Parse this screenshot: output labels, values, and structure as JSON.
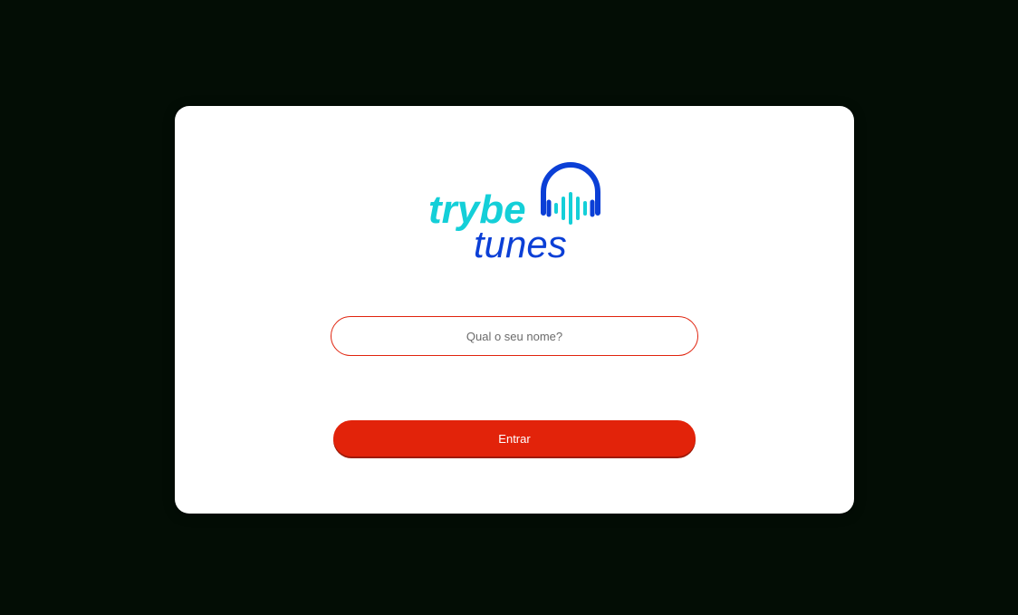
{
  "logo": {
    "word1": "trybe",
    "word2": "tunes",
    "icon": "headphones-soundwave-icon",
    "colors": {
      "trybe": "#14cfd8",
      "tunes": "#0b3fd6",
      "headphones": "#0b3fd6",
      "wave": "#14cfd8"
    }
  },
  "login": {
    "name_placeholder": "Qual o seu nome?",
    "name_value": "",
    "submit_label": "Entrar"
  },
  "colors": {
    "background": "#030d05",
    "card": "#ffffff",
    "accent": "#e2230a"
  }
}
